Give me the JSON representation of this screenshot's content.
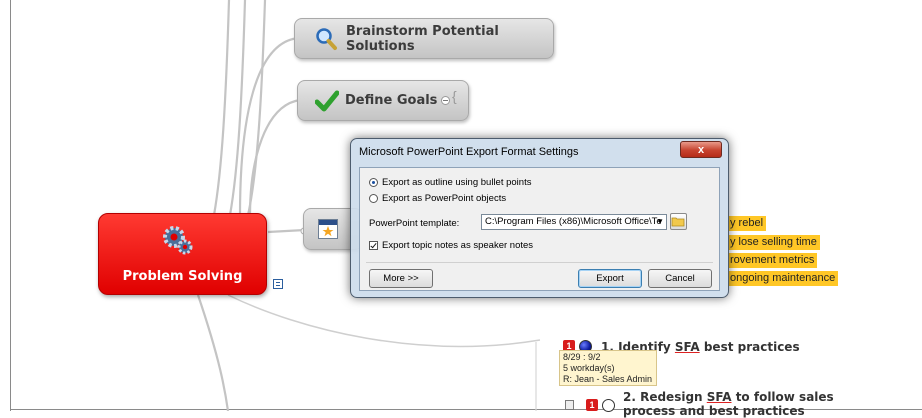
{
  "map": {
    "central_topic": "Problem Solving",
    "topics": {
      "brainstorm": "Brainstorm Potential Solutions",
      "define_goals": "Define Goals"
    },
    "highlighted_items": [
      "y rebel",
      "y lose selling time",
      "rovement metrics",
      "ongoing maintenance"
    ],
    "tasks": [
      {
        "priority": "1",
        "title_prefix": "1. Identify ",
        "title_keyword": "SFA",
        "title_suffix": " best practices",
        "notes": [
          "8/29 : 9/2",
          "5 workday(s)",
          "R: Jean - Sales Admin"
        ]
      },
      {
        "priority": "1",
        "title_prefix": "2. Redesign ",
        "title_keyword": "SFA",
        "title_suffix": " to follow sales",
        "title_line2": "process and best practices"
      }
    ]
  },
  "dialog": {
    "title": "Microsoft PowerPoint Export Format Settings",
    "close_label": "x",
    "option_outline": "Export as outline using bullet points",
    "option_objects": "Export as PowerPoint objects",
    "selected_option": "outline",
    "template_label": "PowerPoint template:",
    "template_value": "C:\\Program Files (x86)\\Microsoft Office\\Te",
    "notes_checkbox_label": "Export topic notes as speaker notes",
    "notes_checked": true,
    "more_button": "More >>",
    "export_button": "Export",
    "cancel_button": "Cancel"
  },
  "icons": {
    "brainstorm": "magnifier-icon",
    "define_goals": "checkmark-icon",
    "central": "gears-icon",
    "notes": "notes-icon",
    "star_topic": "star-slide-icon"
  },
  "colors": {
    "central": "#e00000",
    "highlight": "#ffc726",
    "check_green": "#2fa12f"
  }
}
